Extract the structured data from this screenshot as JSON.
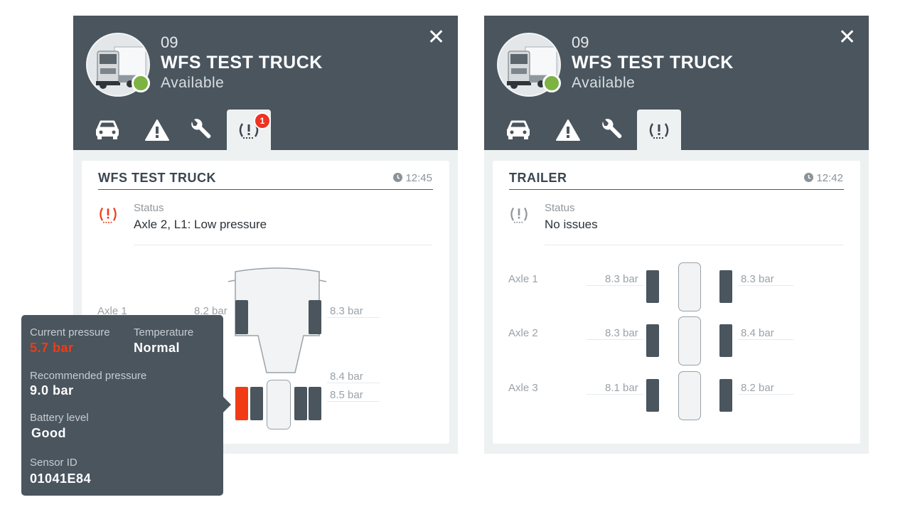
{
  "colors": {
    "header": "#4a555e",
    "alert": "#f03b16",
    "online": "#7cb342",
    "badge": "#ee3322"
  },
  "left_card": {
    "header": {
      "number": "09",
      "name": "WFS TEST TRUCK",
      "status": "Available"
    },
    "tabs": [
      {
        "icon": "car-icon"
      },
      {
        "icon": "warning-icon"
      },
      {
        "icon": "wrench-icon"
      },
      {
        "icon": "tire-pressure-icon",
        "badge": "1",
        "active": true
      }
    ],
    "panel": {
      "title": "WFS TEST TRUCK",
      "time": "12:45",
      "status_label": "Status",
      "status_value": "Axle 2, L1: Low pressure",
      "axles": [
        {
          "label": "Axle 1",
          "left": "8.2 bar",
          "right": "8.3 bar"
        },
        {
          "label": "",
          "left": "",
          "right": "8.4 bar"
        },
        {
          "label": "",
          "left": "",
          "right": "8.5 bar"
        }
      ]
    }
  },
  "tooltip": {
    "current_pressure_label": "Current pressure",
    "current_pressure": "5.7 bar",
    "temperature_label": "Temperature",
    "temperature": "Normal",
    "recommended_label": "Recommended pressure",
    "recommended": "9.0 bar",
    "battery_label": "Battery level",
    "battery": "Good",
    "sensor_label": "Sensor ID",
    "sensor": "01041E84"
  },
  "right_card": {
    "header": {
      "number": "09",
      "name": "WFS TEST TRUCK",
      "status": "Available"
    },
    "tabs": [
      {
        "icon": "car-icon"
      },
      {
        "icon": "warning-icon"
      },
      {
        "icon": "wrench-icon"
      },
      {
        "icon": "tire-pressure-icon",
        "active": true
      }
    ],
    "panel": {
      "title": "TRAILER",
      "time": "12:42",
      "status_label": "Status",
      "status_value": "No issues",
      "axles": [
        {
          "label": "Axle 1",
          "left": "8.3 bar",
          "right": "8.3 bar"
        },
        {
          "label": "Axle 2",
          "left": "8.3 bar",
          "right": "8.4 bar"
        },
        {
          "label": "Axle 3",
          "left": "8.1 bar",
          "right": "8.2 bar"
        }
      ]
    }
  }
}
